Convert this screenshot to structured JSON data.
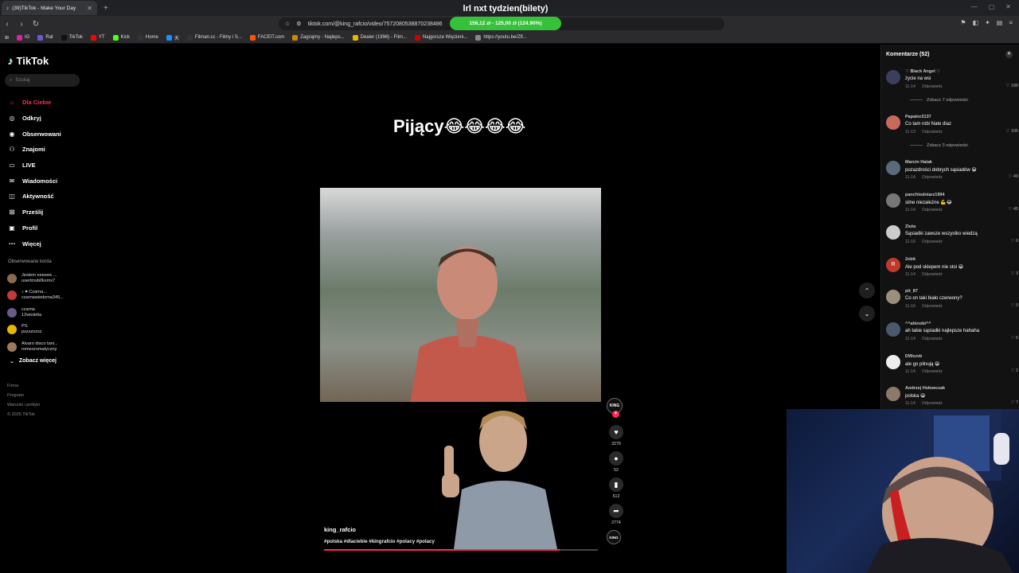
{
  "browser": {
    "tab_title": "(39)TikTok - Make Your Day",
    "overlay_title": "lrl nxt tydzien(bilety)",
    "url": "tiktok.com/@king_rafcio/video/7572080538870238486",
    "donation_bar": "156,12 zł - 125,00 zł (124.90%)",
    "bookmarks": [
      {
        "label": "IG",
        "color": "#d6249f"
      },
      {
        "label": "Rat",
        "color": "#6a5acd"
      },
      {
        "label": "TikTok",
        "color": "#111111"
      },
      {
        "label": "YT",
        "color": "#ff0000"
      },
      {
        "label": "Kick",
        "color": "#53fc18"
      },
      {
        "label": "Home",
        "color": "#333333"
      },
      {
        "label": "天",
        "color": "#1e90ff"
      },
      {
        "label": "Filman.cc - Filmy i S...",
        "color": "#333333"
      },
      {
        "label": "FACEIT.com",
        "color": "#ff5500"
      },
      {
        "label": "Zagrajmy - Najleps...",
        "color": "#cc8800"
      },
      {
        "label": "Dealer (1996) - Film...",
        "color": "#e6b800"
      },
      {
        "label": "Najgorsze Więzieni...",
        "color": "#cc0000"
      },
      {
        "label": "https://youtu.be/Zfl...",
        "color": "#888888"
      }
    ]
  },
  "sidebar": {
    "brand": "TikTok",
    "search_placeholder": "Szukaj",
    "nav": [
      {
        "label": "Dla Ciebie",
        "icon": "home-icon",
        "glyph": "⌂"
      },
      {
        "label": "Odkryj",
        "icon": "compass-icon",
        "glyph": "◎"
      },
      {
        "label": "Obserwowani",
        "icon": "following-icon",
        "glyph": "◉"
      },
      {
        "label": "Znajomi",
        "icon": "friends-icon",
        "glyph": "⚇"
      },
      {
        "label": "LIVE",
        "icon": "live-icon",
        "glyph": "▭"
      },
      {
        "label": "Wiadomości",
        "icon": "messages-icon",
        "glyph": "✉"
      },
      {
        "label": "Aktywność",
        "icon": "activity-icon",
        "glyph": "◫"
      },
      {
        "label": "Prześlij",
        "icon": "upload-icon",
        "glyph": "⊞"
      },
      {
        "label": "Profil",
        "icon": "profile-icon",
        "glyph": "▣"
      },
      {
        "label": "Więcej",
        "icon": "more-icon",
        "glyph": "⋯"
      }
    ],
    "followed_title": "Obserwowane konta",
    "followed": [
      {
        "name": "Jestem eeeeee ...",
        "handle": "usertmsb0kxmx7"
      },
      {
        "name": "♪ ♥ Czarna...",
        "handle": "czarnawiedzma345..."
      },
      {
        "name": "czarna",
        "handle": "12wioletta"
      },
      {
        "name": "PS",
        "handle": "pszszszsz"
      },
      {
        "name": "Alvaro disco tani...",
        "handle": "romeoromatyczny"
      }
    ],
    "see_more": "Zobacz więcej",
    "footer": [
      "Firma",
      "Program",
      "Warunki i polityki",
      "© 2025 TikTok"
    ]
  },
  "video": {
    "caption_title": "Pijący😂😂😂😂",
    "author": "king_rafcio",
    "tags": "#polska #dlaciebie #kingrafcio #polacy #polacy",
    "progress": 0.86,
    "badge": "KING",
    "likes": "3279",
    "comments": "52",
    "saves": "512",
    "shares": "2774"
  },
  "comments_panel": {
    "title": "Komentarze (52)",
    "items": [
      {
        "user": "♡ Black Angel ♡",
        "text": "życie na wsi",
        "date": "11-14",
        "reply": "Odpowiedz",
        "likes": "188",
        "more": "Zobacz 7 odpowiedzi",
        "avatar_color": "#3b3f5c"
      },
      {
        "user": "Papator2137",
        "text": "Co tam robi Nate diaz",
        "date": "11-13",
        "reply": "Odpowiedz",
        "likes": "105",
        "more": "Zobacz 3 odpowiedzi",
        "avatar_color": "#c76a5a"
      },
      {
        "user": "Marcin Halak",
        "text": "pozazdrości dobrych sąsiadów 😁",
        "date": "11-14",
        "reply": "Odpowiedz",
        "likes": "49",
        "more": "",
        "avatar_color": "#5a6a7a"
      },
      {
        "user": "panchlodniarz1994",
        "text": "silne niezależne 💪😂",
        "date": "11-14",
        "reply": "Odpowiedz",
        "likes": "45",
        "more": "",
        "avatar_color": "#777777"
      },
      {
        "user": "Ziuta",
        "text": "Sąsiadki zawsze wszystko wiedzą",
        "date": "11-16",
        "reply": "Odpowiedz",
        "likes": "0",
        "more": "",
        "avatar_color": "#cccccc"
      },
      {
        "user": "2xbit",
        "text": "Ale pod sklepem nie stoi 😁",
        "date": "11-14",
        "reply": "Odpowiedz",
        "likes": "3",
        "more": "",
        "avatar_color": "#c0392b",
        "initial": "R"
      },
      {
        "user": "pit_87",
        "text": "Co on taki biało czerwony?",
        "date": "11-16",
        "reply": "Odpowiedz",
        "likes": "0",
        "more": "",
        "avatar_color": "#9a8f7a"
      },
      {
        "user": "^^ahinobi^^",
        "text": "ah takie sąsiadki najlepsze hahaha",
        "date": "11-14",
        "reply": "Odpowiedz",
        "likes": "6",
        "more": "",
        "avatar_color": "#4a5a6a"
      },
      {
        "user": "DWszvb",
        "text": "ale go pilnują 😁",
        "date": "11-14",
        "reply": "Odpowiedz",
        "likes": "2",
        "more": "",
        "avatar_color": "#eeeeee"
      },
      {
        "user": "Andrzej Hołowczak",
        "text": "polska 😁",
        "date": "11-14",
        "reply": "Odpowiedz",
        "likes": "7",
        "more": "",
        "avatar_color": "#8a7a6a"
      }
    ]
  }
}
